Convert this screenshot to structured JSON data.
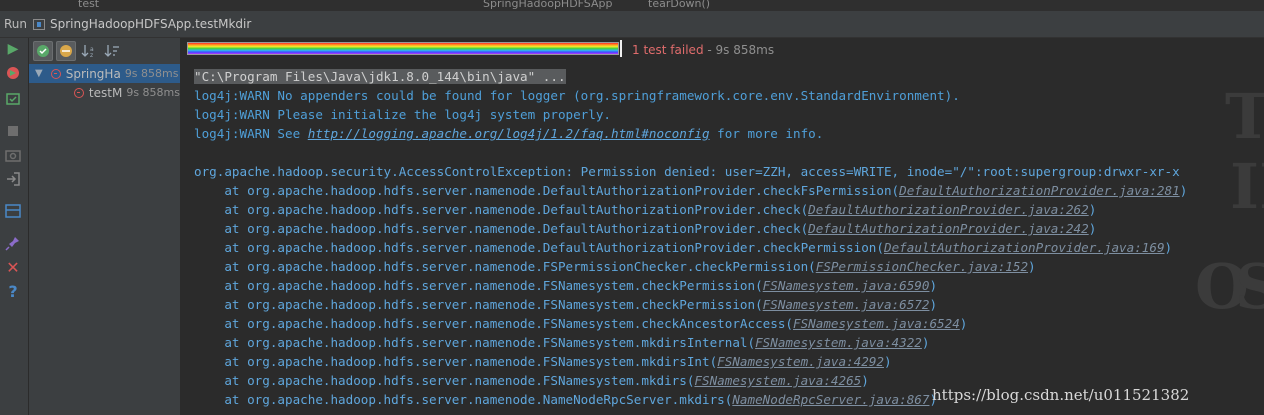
{
  "top_ghost": {
    "left": "test",
    "center": "SpringHadoopHDFSApp",
    "right": "tearDown()"
  },
  "run_bar": {
    "label": "Run",
    "config_title": "SpringHadoopHDFSApp.testMkdir"
  },
  "tree": {
    "rows": [
      {
        "name": "SpringHa",
        "time": "9s 858ms"
      },
      {
        "name": "testM",
        "time": "9s 858ms"
      }
    ]
  },
  "status": {
    "failed_text": "1 test failed",
    "separator": " - ",
    "time": "9s 858ms"
  },
  "progress": {
    "fraction": 1.0
  },
  "console": {
    "command": "\"C:\\Program Files\\Java\\jdk1.8.0_144\\bin\\java\" ...",
    "warn1": "log4j:WARN No appenders could be found for logger (org.springframework.core.env.StandardEnvironment).",
    "warn2": "log4j:WARN Please initialize the log4j system properly.",
    "warn3_prefix": "log4j:WARN See ",
    "warn3_url": "http://logging.apache.org/log4j/1.2/faq.html#noconfig",
    "warn3_suffix": " for more info.",
    "exception": "org.apache.hadoop.security.AccessControlException: Permission denied: user=ZZH, access=WRITE, inode=\"/\":root:supergroup:drwxr-xr-x",
    "stack": [
      {
        "method": "    at org.apache.hadoop.hdfs.server.namenode.DefaultAuthorizationProvider.checkFsPermission(",
        "file": "DefaultAuthorizationProvider.java:281",
        "close": ")"
      },
      {
        "method": "    at org.apache.hadoop.hdfs.server.namenode.DefaultAuthorizationProvider.check(",
        "file": "DefaultAuthorizationProvider.java:262",
        "close": ")"
      },
      {
        "method": "    at org.apache.hadoop.hdfs.server.namenode.DefaultAuthorizationProvider.check(",
        "file": "DefaultAuthorizationProvider.java:242",
        "close": ")"
      },
      {
        "method": "    at org.apache.hadoop.hdfs.server.namenode.DefaultAuthorizationProvider.checkPermission(",
        "file": "DefaultAuthorizationProvider.java:169",
        "close": ")"
      },
      {
        "method": "    at org.apache.hadoop.hdfs.server.namenode.FSPermissionChecker.checkPermission(",
        "file": "FSPermissionChecker.java:152",
        "close": ")"
      },
      {
        "method": "    at org.apache.hadoop.hdfs.server.namenode.FSNamesystem.checkPermission(",
        "file": "FSNamesystem.java:6590",
        "close": ")"
      },
      {
        "method": "    at org.apache.hadoop.hdfs.server.namenode.FSNamesystem.checkPermission(",
        "file": "FSNamesystem.java:6572",
        "close": ")"
      },
      {
        "method": "    at org.apache.hadoop.hdfs.server.namenode.FSNamesystem.checkAncestorAccess(",
        "file": "FSNamesystem.java:6524",
        "close": ")"
      },
      {
        "method": "    at org.apache.hadoop.hdfs.server.namenode.FSNamesystem.mkdirsInternal(",
        "file": "FSNamesystem.java:4322",
        "close": ")"
      },
      {
        "method": "    at org.apache.hadoop.hdfs.server.namenode.FSNamesystem.mkdirsInt(",
        "file": "FSNamesystem.java:4292",
        "close": ")"
      },
      {
        "method": "    at org.apache.hadoop.hdfs.server.namenode.FSNamesystem.mkdirs(",
        "file": "FSNamesystem.java:4265",
        "close": ")"
      },
      {
        "method": "    at org.apache.hadoop.hdfs.server.namenode.NameNodeRpcServer.mkdirs(",
        "file": "NameNodeRpcServer.java:867",
        "close": ")"
      }
    ]
  },
  "watermark_text": "https://blog.csdn.net/u011521382",
  "colors": {
    "fail": "#e06c6c",
    "selection": "#2d5b8a",
    "console_blue": "#4f9fd8"
  }
}
